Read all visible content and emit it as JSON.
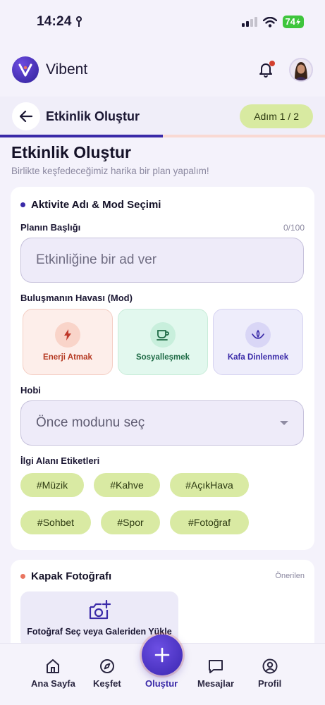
{
  "status_bar": {
    "time": "14:24",
    "battery": "74"
  },
  "header": {
    "app_name": "Vibent",
    "logo_letter": "V"
  },
  "sub_header": {
    "title": "Etkinlik Oluştur",
    "step": "Adım 1 / 2",
    "progress": 0.5
  },
  "page": {
    "title": "Etkinlik Oluştur",
    "subtitle": "Birlikte keşfedeceğimiz harika bir plan yapalım!"
  },
  "activity_section": {
    "title": "Aktivite Adı & Mod Seçimi",
    "plan_title_label": "Planın Başlığı",
    "counter": "0/100",
    "plan_title_placeholder": "Etkinliğine bir ad ver",
    "mode_label": "Buluşmanın Havası (Mod)",
    "modes": [
      {
        "label": "Enerji Atmak",
        "icon": "lightning-icon"
      },
      {
        "label": "Sosyalleşmek",
        "icon": "coffee-icon"
      },
      {
        "label": "Kafa Dinlenmek",
        "icon": "lotus-icon"
      }
    ],
    "hobby_label": "Hobi",
    "hobby_value": "Önce modunu seç",
    "tags_label": "İlgi Alanı Etiketleri",
    "tags_row1": [
      "#Müzik",
      "#Kahve",
      "#AçıkHava"
    ],
    "tags_row2": [
      "#Sohbet",
      "#Spor",
      "#Fotoğraf"
    ]
  },
  "photo_section": {
    "title": "Kapak Fotoğrafı",
    "recommended": "Önerilen",
    "upload_text": "Fotoğraf Seç veya Galeriden Yükle"
  },
  "nav": {
    "home": "Ana Sayfa",
    "explore": "Keşfet",
    "create": "Oluştur",
    "messages": "Mesajlar",
    "profile": "Profil"
  },
  "colors": {
    "primary": "#3a2aa8",
    "accent_orange": "#e97560",
    "tag_green": "#d9eaa3"
  }
}
